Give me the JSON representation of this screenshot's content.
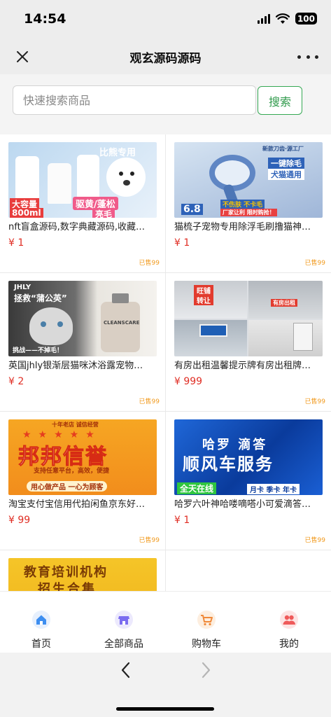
{
  "status": {
    "time": "14:54",
    "battery": "100"
  },
  "nav": {
    "title": "观玄源码源码"
  },
  "search": {
    "placeholder": "快速搜索商品",
    "button_label": "搜索"
  },
  "products": [
    {
      "title": "nft盲盒源码,数字典藏源码,收藏…",
      "price": "¥ 1",
      "sold": "已售99",
      "image_text": [
        "比熊专用",
        "大容量",
        "800ml",
        "驱黄/蓬松",
        "亮毛"
      ]
    },
    {
      "title": "猫梳子宠物专用除浮毛刷撸猫神…",
      "price": "¥ 1",
      "sold": "已售99",
      "image_text": [
        "新款刀齿·源工厂",
        "一键除毛",
        "犬猫通用",
        "不伤肤 不卡毛",
        "厂家让利 限时购抢！",
        "6.8"
      ]
    },
    {
      "title": "英国jhly银渐层猫咪沐浴露宠物…",
      "price": "¥ 2",
      "sold": "已售99",
      "image_text": [
        "JHLY",
        "拯救“蒲公英”",
        "挑战——不掉毛！",
        "CLEANSCARE"
      ]
    },
    {
      "title": "有房出租温馨提示牌有房出租牌…",
      "price": "¥ 999",
      "sold": "已售99",
      "image_text": [
        "旺铺",
        "转让",
        "有房出租"
      ]
    },
    {
      "title": "淘宝支付宝信用代拍闲鱼京东好…",
      "price": "¥ 99",
      "sold": "已售99",
      "image_text": [
        "十年老店 诚信经营",
        "邦邦信誉",
        "支持任意平台，高效，便捷",
        "用心做产品 一心为顾客"
      ]
    },
    {
      "title": "哈罗六叶神哈喽嘀嗒小可爱滴答…",
      "price": "¥ 1",
      "sold": "已售99",
      "image_text": [
        "哈罗 滴答",
        "顺风车服务",
        "全天在线",
        "月卡 季卡 年卡"
      ]
    },
    {
      "title": "",
      "price": "",
      "sold": "",
      "image_text": [
        "教育培训机构",
        "招生合集"
      ]
    }
  ],
  "tabs": [
    {
      "label": "首页",
      "icon": "home-icon"
    },
    {
      "label": "全部商品",
      "icon": "store-icon"
    },
    {
      "label": "购物车",
      "icon": "cart-icon"
    },
    {
      "label": "我的",
      "icon": "users-icon"
    }
  ],
  "colors": {
    "accent_green": "#35a853",
    "price_red": "#e02e24",
    "sold_orange": "#f19a1e",
    "home_blue": "#3d8ef0",
    "store_purple": "#7b6cf0",
    "cart_orange": "#f08a3a",
    "mine_red": "#ef5a5a"
  }
}
